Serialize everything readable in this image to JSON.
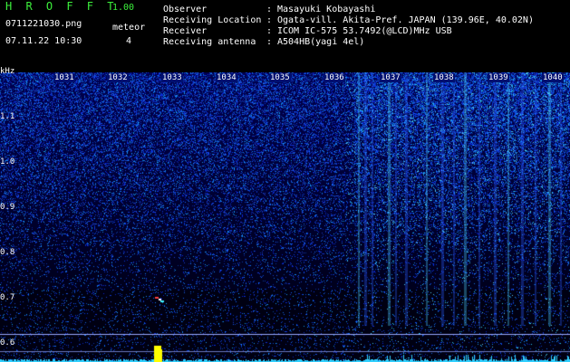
{
  "header": {
    "app_name": "H R O F F T",
    "version": "1.00",
    "filename": "0711221030.png",
    "datetime": "07.11.22 10:30",
    "meteor_label": "meteor",
    "meteor_count": "4",
    "fields": [
      {
        "label": "Observer",
        "sep": ":",
        "value": "Masayuki Kobayashi"
      },
      {
        "label": "Receiving Location",
        "sep": ":",
        "value": "Ogata-vill. Akita-Pref. JAPAN (139.96E, 40.02N)"
      },
      {
        "label": "Receiver",
        "sep": ":",
        "value": "ICOM IC-575 53.7492(@LCD)MHz USB"
      },
      {
        "label": "Receiving antenna",
        "sep": ":",
        "value": "A504HB(yagi 4el)"
      }
    ]
  },
  "spectrogram": {
    "y_unit": "kHz",
    "y_ticks": [
      "1.1",
      "1.0",
      "0.9",
      "0.8",
      "0.7",
      "0.6"
    ],
    "time_ticks": [
      "1031",
      "1032",
      "1033",
      "1034",
      "1035",
      "1036",
      "1037",
      "1038",
      "1039",
      "1040"
    ],
    "colors": {
      "background": "#00005a",
      "noise": "#1a3cff",
      "bright": "#3cf0ff",
      "meteor": "#ffff00"
    }
  }
}
